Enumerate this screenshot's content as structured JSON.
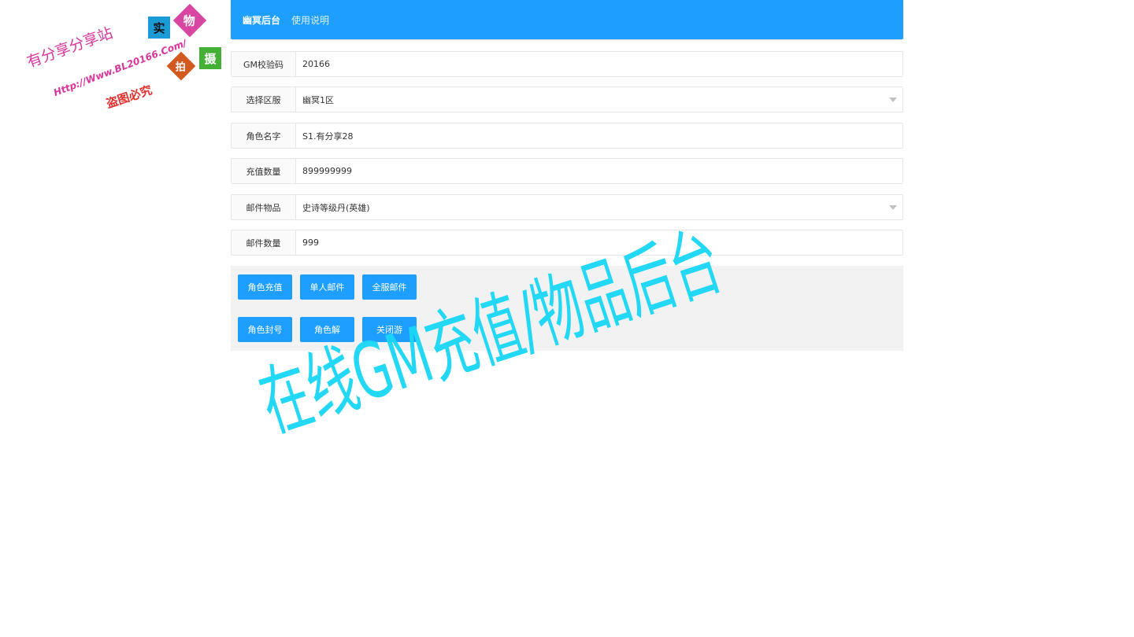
{
  "watermark": {
    "tag_shi": "实",
    "tag_wu": "物",
    "tag_pai": "拍",
    "tag_she": "摄",
    "slogan": "有分享分享站",
    "url": "Http://Www.BL20166.Com/",
    "warning": "盗图必究"
  },
  "header": {
    "brand": "幽冥后台",
    "help_link": "使用说明",
    "bar_color": "#1e9fff"
  },
  "form": {
    "gm_code": {
      "label": "GM校验码",
      "value": "20166"
    },
    "server": {
      "label": "选择区服",
      "value": "幽冥1区"
    },
    "role_name": {
      "label": "角色名字",
      "value": "S1.有分享28"
    },
    "recharge_amount": {
      "label": "充值数量",
      "value": "899999999"
    },
    "mail_item": {
      "label": "邮件物品",
      "value": "史诗等级丹(英雄)"
    },
    "mail_quantity": {
      "label": "邮件数量",
      "value": "999"
    }
  },
  "buttons": {
    "role_recharge": "角色充值",
    "single_mail": "单人邮件",
    "all_server_mail": "全服邮件",
    "ban_role": "角色封号",
    "unban_role": "角色解",
    "close_game": "关闭游"
  },
  "overlay_text": "在线GM充值/物品后台",
  "colors": {
    "accent": "#1e9fff",
    "overlay": "#1ad7f5"
  }
}
